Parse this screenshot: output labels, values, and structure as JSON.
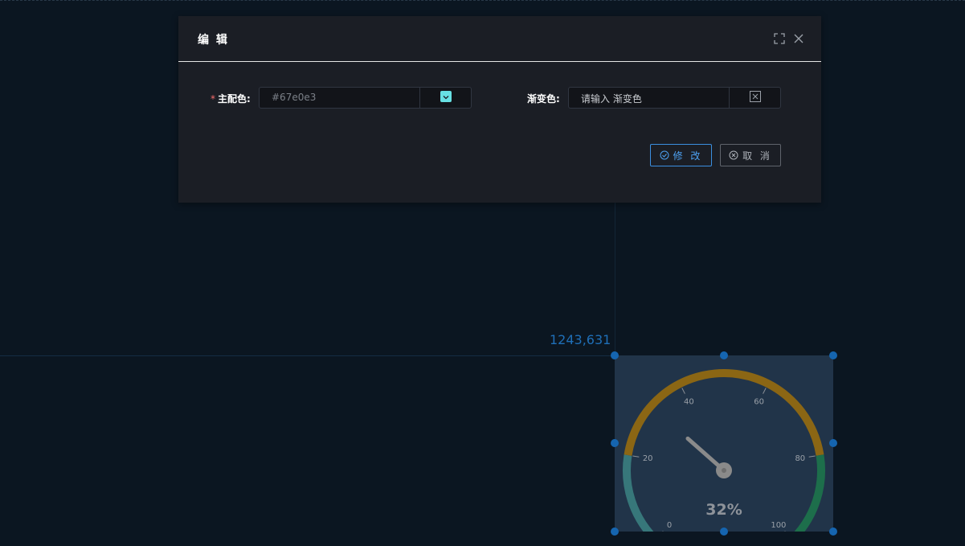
{
  "dialog": {
    "title": "编 辑",
    "primary_color_label": "主配色:",
    "required_mark": "*",
    "primary_color_value": "#67e0e3",
    "gradient_label": "渐变色:",
    "gradient_placeholder": "请输入 渐变色",
    "submit_label": "修 改",
    "cancel_label": "取 消"
  },
  "canvas": {
    "coordinate_readout": "1243,631"
  },
  "gauge": {
    "value_text": "32%",
    "value": 32,
    "min": 0,
    "max": 100,
    "tick_labels": [
      "0",
      "20",
      "40",
      "60",
      "80",
      "100"
    ],
    "band_colors": [
      "#37777a",
      "#8b6614",
      "#1d6e4b"
    ],
    "pointer_color": "#8a8a8a",
    "selection_color": "#1565b0"
  },
  "colors": {
    "swatch": "#67e0e3",
    "accent": "#3b8fe0"
  }
}
